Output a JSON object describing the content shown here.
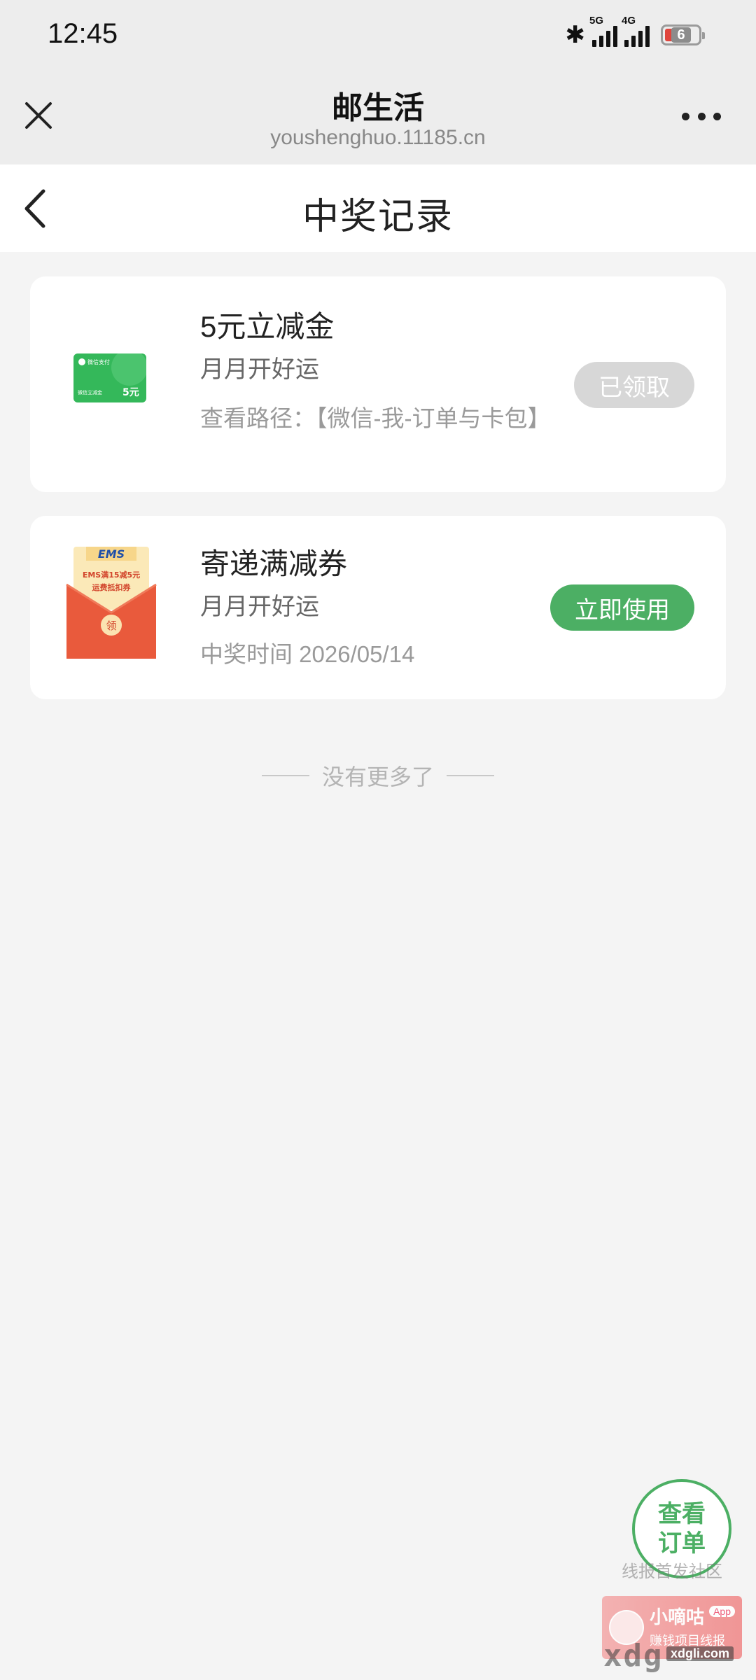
{
  "status_bar": {
    "time": "12:45",
    "network_1": "5G",
    "network_2": "4G",
    "battery": "6"
  },
  "web_bar": {
    "title": "邮生活",
    "url": "youshenghuo.11185.cn",
    "close_icon": "close-icon",
    "more_icon": "more-icon"
  },
  "page": {
    "title": "中奖记录",
    "back_icon": "chevron-left-icon"
  },
  "prizes": [
    {
      "title": "5元立减金",
      "subtitle": "月月开好运",
      "info": "查看路径：【微信-我-订单与卡包】",
      "action": "已领取",
      "thumb_brand": "微信支付",
      "thumb_amount": "5元",
      "thumb_caption": "微信立减金"
    },
    {
      "title": "寄递满减券",
      "subtitle": "月月开好运",
      "info": "中奖时间 2026/05/14",
      "action": "立即使用",
      "thumb_brand": "EMS",
      "thumb_line1": "EMS满15减5元",
      "thumb_line2": "运费抵扣券",
      "thumb_badge": "领"
    }
  ],
  "footer_note": "没有更多了",
  "float_button": {
    "line1": "查看",
    "line2": "订单"
  },
  "watermark": {
    "community": "线报首发社区",
    "brand": "小嘀咕",
    "slogan": "赚钱项目线报",
    "app_tag": "App",
    "domain_big": "xdg",
    "domain_small": "xdgli.com"
  },
  "colors": {
    "accent_green": "#4caf64",
    "claimed_gray": "#d7d7d7",
    "page_bg": "#f4f4f4"
  }
}
